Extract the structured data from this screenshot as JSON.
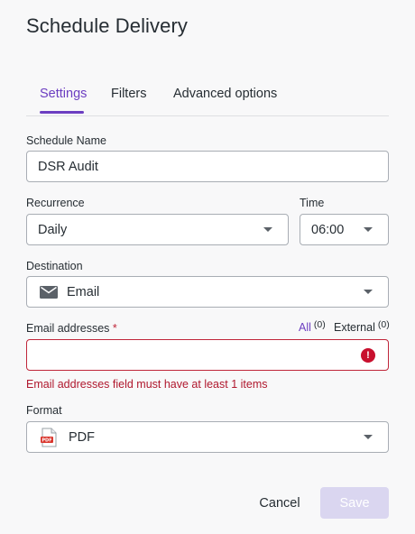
{
  "dialog": {
    "title": "Schedule Delivery"
  },
  "tabs": [
    {
      "label": "Settings",
      "active": true
    },
    {
      "label": "Filters",
      "active": false
    },
    {
      "label": "Advanced options",
      "active": false
    }
  ],
  "schedule_name": {
    "label": "Schedule Name",
    "value": "DSR Audit"
  },
  "recurrence": {
    "label": "Recurrence",
    "value": "Daily"
  },
  "time": {
    "label": "Time",
    "value": "06:00"
  },
  "destination": {
    "label": "Destination",
    "value": "Email",
    "icon": "envelope-icon"
  },
  "email_addresses": {
    "label": "Email addresses",
    "required_mark": "*",
    "value": "",
    "error": "Email addresses field must have at least 1 items",
    "all_label": "All",
    "all_count": "(0)",
    "external_label": "External",
    "external_count": "(0)"
  },
  "format": {
    "label": "Format",
    "value": "PDF",
    "icon": "pdf-file-icon"
  },
  "actions": {
    "cancel_label": "Cancel",
    "save_label": "Save"
  },
  "colors": {
    "accent": "#6c3ec1",
    "error": "#c0263a",
    "save_disabled": "#dad6f0"
  }
}
